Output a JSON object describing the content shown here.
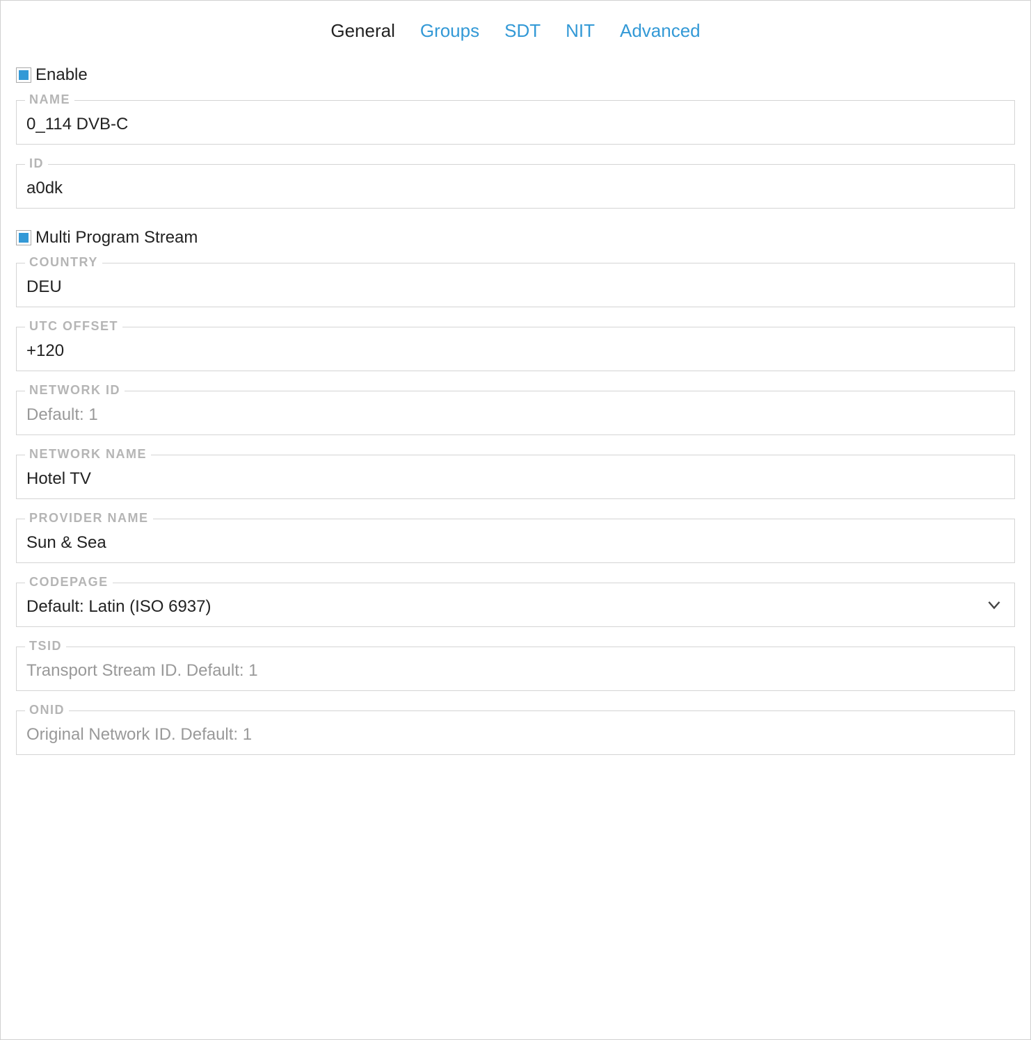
{
  "tabs": {
    "general": {
      "label": "General",
      "active": true
    },
    "groups": {
      "label": "Groups",
      "active": false
    },
    "sdt": {
      "label": "SDT",
      "active": false
    },
    "nit": {
      "label": "NIT",
      "active": false
    },
    "advanced": {
      "label": "Advanced",
      "active": false
    }
  },
  "enable": {
    "label": "Enable",
    "checked": true
  },
  "name": {
    "label": "NAME",
    "value": "0_114 DVB-C"
  },
  "id": {
    "label": "ID",
    "value": "a0dk"
  },
  "mps": {
    "label": "Multi Program Stream",
    "checked": true
  },
  "country": {
    "label": "COUNTRY",
    "value": "DEU"
  },
  "utc_offset": {
    "label": "UTC OFFSET",
    "value": "+120"
  },
  "network_id": {
    "label": "NETWORK ID",
    "value": "",
    "placeholder": "Default: 1"
  },
  "network_name": {
    "label": "NETWORK NAME",
    "value": "Hotel TV"
  },
  "provider_name": {
    "label": "PROVIDER NAME",
    "value": "Sun & Sea"
  },
  "codepage": {
    "label": "CODEPAGE",
    "value": "Default: Latin (ISO 6937)"
  },
  "tsid": {
    "label": "TSID",
    "value": "",
    "placeholder": "Transport Stream ID. Default: 1"
  },
  "onid": {
    "label": "ONID",
    "value": "",
    "placeholder": "Original Network ID. Default: 1"
  }
}
